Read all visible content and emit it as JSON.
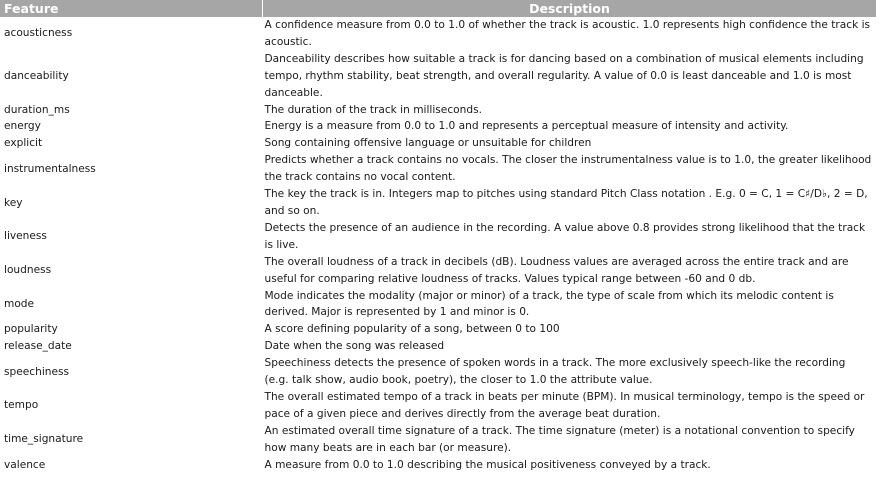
{
  "table": {
    "headers": [
      "Feature",
      "Description"
    ],
    "rows": [
      {
        "feature": "acousticness",
        "description": " A confidence measure from 0.0 to 1.0 of whether the track is acoustic. 1.0 represents high confidence the track is acoustic."
      },
      {
        "feature": "danceability",
        "description": " Danceability describes how suitable a track is for dancing based on a combination of musical elements including tempo, rhythm stability, beat strength, and overall regularity. A value of 0.0 is least danceable and 1.0 is most danceable."
      },
      {
        "feature": "duration_ms",
        "description": "The duration of the track in milliseconds."
      },
      {
        "feature": "energy",
        "description": " Energy is a measure from 0.0 to 1.0 and represents a perceptual measure of intensity and activity."
      },
      {
        "feature": "explicit",
        "description": "Song containing offensive language or unsuitable for children"
      },
      {
        "feature": "instrumentalness",
        "description": " Predicts whether a track contains no vocals. The closer the instrumentalness value is to 1.0, the greater likelihood the track contains no vocal content."
      },
      {
        "feature": "key",
        "description": "The key the track is in. Integers map to pitches using standard Pitch Class notation . E.g. 0 = C, 1 = C♯/D♭, 2 = D, and so on."
      },
      {
        "feature": "liveness",
        "description": " Detects the presence of an audience in the recording. A value above 0.8 provides strong likelihood that the track is live."
      },
      {
        "feature": "loudness",
        "description": " The overall loudness of a track in decibels (dB). Loudness values are averaged across the entire track and are useful for comparing relative loudness of tracks. Values typical range between -60 and 0 db."
      },
      {
        "feature": "mode",
        "description": " Mode indicates the modality (major or minor) of a track, the type of scale from which its melodic content is derived. Major is represented by 1 and minor is 0."
      },
      {
        "feature": "popularity",
        "description": "A score defining popularity of a song, between 0 to 100"
      },
      {
        "feature": "release_date",
        "description": "Date when the song was released"
      },
      {
        "feature": "speechiness",
        "description": "Speechiness detects the presence of spoken words in a track. The more exclusively speech-like the recording (e.g. talk show, audio book, poetry), the closer to 1.0 the attribute value."
      },
      {
        "feature": "tempo",
        "description": " The overall estimated tempo of a track in beats per minute (BPM). In musical terminology, tempo is the speed or pace of a given piece and derives directly from the average beat duration."
      },
      {
        "feature": "time_signature",
        "description": " An estimated overall time signature of a track. The time signature (meter) is a notational convention to specify how many beats are in each bar (or measure)."
      },
      {
        "feature": "valence",
        "description": " A measure from 0.0 to 1.0 describing the musical positiveness conveyed by a track."
      }
    ]
  },
  "colors": {
    "header_bg": "#a6a6a6",
    "header_text": "#ffffff",
    "body_text": "#1a1a1a"
  }
}
